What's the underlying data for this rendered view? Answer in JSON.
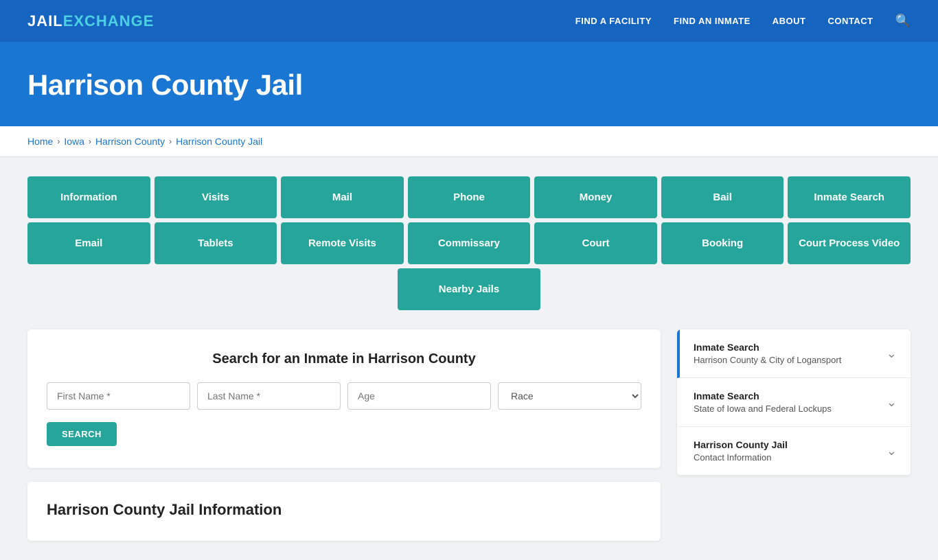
{
  "header": {
    "logo_jail": "JAIL",
    "logo_exchange": "EXCHANGE",
    "nav": [
      {
        "label": "FIND A FACILITY",
        "id": "find-facility"
      },
      {
        "label": "FIND AN INMATE",
        "id": "find-inmate"
      },
      {
        "label": "ABOUT",
        "id": "about"
      },
      {
        "label": "CONTACT",
        "id": "contact"
      }
    ]
  },
  "hero": {
    "title": "Harrison County Jail"
  },
  "breadcrumb": {
    "items": [
      "Home",
      "Iowa",
      "Harrison County",
      "Harrison County Jail"
    ]
  },
  "buttons_row1": [
    "Information",
    "Visits",
    "Mail",
    "Phone",
    "Money",
    "Bail",
    "Inmate Search"
  ],
  "buttons_row2": [
    "Email",
    "Tablets",
    "Remote Visits",
    "Commissary",
    "Court",
    "Booking",
    "Court Process Video"
  ],
  "buttons_row3": [
    "Nearby Jails"
  ],
  "search": {
    "title": "Search for an Inmate in Harrison County",
    "first_name_placeholder": "First Name *",
    "last_name_placeholder": "Last Name *",
    "age_placeholder": "Age",
    "race_placeholder": "Race",
    "button_label": "SEARCH"
  },
  "info_section": {
    "title": "Harrison County Jail Information"
  },
  "sidebar": {
    "items": [
      {
        "title": "Inmate Search",
        "subtitle": "Harrison County & City of Logansport",
        "active": true
      },
      {
        "title": "Inmate Search",
        "subtitle": "State of Iowa and Federal Lockups",
        "active": false
      },
      {
        "title": "Harrison County Jail",
        "subtitle": "Contact Information",
        "active": false
      }
    ]
  }
}
